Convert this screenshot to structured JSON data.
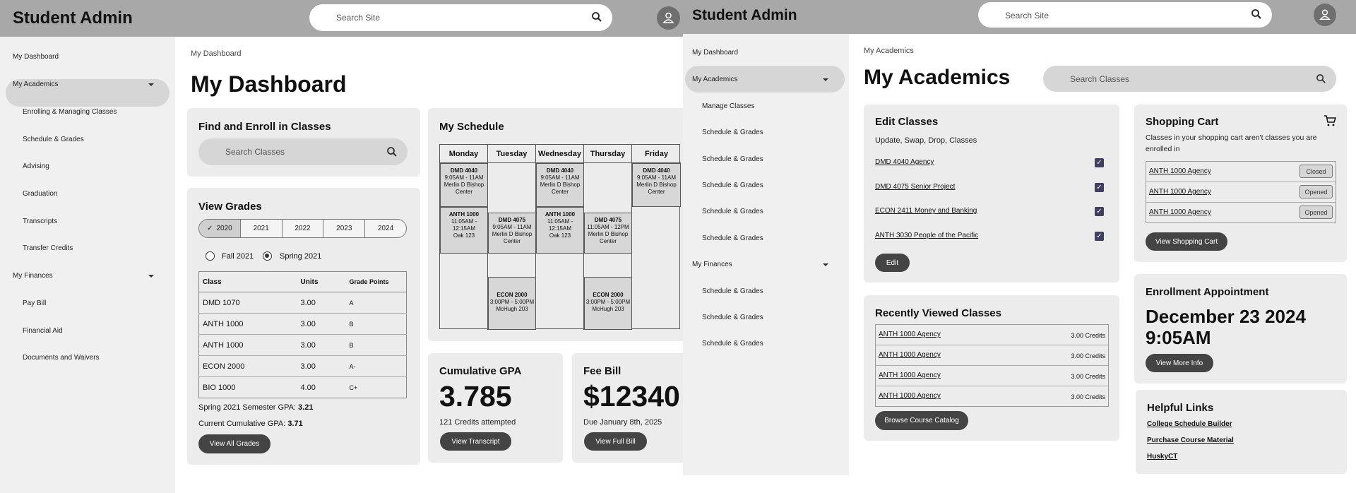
{
  "dashboard": {
    "brand": "Student Admin",
    "search_placeholder": "Search Site",
    "nav": [
      {
        "label": "My Dashboard"
      },
      {
        "label": "My Academics"
      },
      {
        "label": "Enrolling & Managing Classes"
      },
      {
        "label": "Schedule & Grades"
      },
      {
        "label": "Advising"
      },
      {
        "label": "Graduation"
      },
      {
        "label": "Transcripts"
      },
      {
        "label": "Transfer Credits"
      },
      {
        "label": "My Finances"
      },
      {
        "label": "Pay Bill"
      },
      {
        "label": "Financial Aid"
      },
      {
        "label": "Documents and Waivers"
      }
    ],
    "breadcrumb": "My Dashboard",
    "title": "My Dashboard",
    "find_enroll": {
      "title": "Find and Enroll in Classes",
      "search_placeholder": "Search Classes"
    },
    "view_grades": {
      "title": "View Grades",
      "years": [
        "2020",
        "2021",
        "2022",
        "2023",
        "2024"
      ],
      "selected_year": "2020",
      "terms": [
        {
          "label": "Fall 2021",
          "selected": false
        },
        {
          "label": "Spring 2021",
          "selected": true
        }
      ],
      "columns": [
        "Class",
        "Units",
        "Grade Points"
      ],
      "rows": [
        {
          "class": "DMD 1070",
          "units": "3.00",
          "grade": "A"
        },
        {
          "class": "ANTH 1000",
          "units": "3.00",
          "grade": "B"
        },
        {
          "class": "ANTH 1000",
          "units": "3.00",
          "grade": "B"
        },
        {
          "class": "ECON 2000",
          "units": "3.00",
          "grade": "A-"
        },
        {
          "class": "BIO 1000",
          "units": "4.00",
          "grade": "C+"
        }
      ],
      "semester_gpa_label": "Spring 2021 Semester GPA:",
      "semester_gpa": "3.21",
      "cumulative_gpa_label": "Current Cumulative GPA:",
      "cumulative_gpa": "3.71",
      "button": "View All Grades"
    },
    "schedule": {
      "title": "My Schedule",
      "days": [
        "Monday",
        "Tuesday",
        "Wednesday",
        "Thursday",
        "Friday"
      ],
      "events": [
        {
          "day": 0,
          "slot": 0,
          "course": "DMD 4040",
          "time": "9:05AM - 11AM",
          "room": "Merlin D Bishop Center"
        },
        {
          "day": 2,
          "slot": 0,
          "course": "DMD 4040",
          "time": "9:05AM - 11AM",
          "room": "Merlin D Bishop Center"
        },
        {
          "day": 4,
          "slot": 0,
          "course": "DMD 4040",
          "time": "9:05AM - 11AM",
          "room": "Merlin D Bishop Center"
        },
        {
          "day": 1,
          "slot": 1,
          "course": "DMD 4075",
          "time": "9:05AM - 11AM",
          "room": "Merlin D Bishop Center"
        },
        {
          "day": 3,
          "slot": 1,
          "course": "DMD 4075",
          "time": "11:05AM - 12PM",
          "room": "Merlin D Bishop Center"
        },
        {
          "day": 0,
          "slot": 2,
          "course": "ANTH 1000",
          "time": "11:05AM - 12:15AM",
          "room": "Oak 123"
        },
        {
          "day": 2,
          "slot": 2,
          "course": "ANTH 1000",
          "time": "11:05AM - 12:15AM",
          "room": "Oak 123"
        },
        {
          "day": 1,
          "slot": 3,
          "course": "ECON 2000",
          "time": "3:00PM - 5:00PM",
          "room": "McHugh 203"
        },
        {
          "day": 3,
          "slot": 3,
          "course": "ECON 2000",
          "time": "3:00PM - 5:00PM",
          "room": "McHugh 203"
        }
      ]
    },
    "gpa": {
      "title": "Cumulative GPA",
      "value": "3.785",
      "credits": "121 Credits attempted",
      "button": "View Transcript"
    },
    "fee": {
      "title": "Fee Bill",
      "value": "$12340",
      "due": "Due January 8th, 2025",
      "button": "View Full Bill"
    }
  },
  "academics": {
    "brand": "Student Admin",
    "search_placeholder": "Search Site",
    "nav": [
      {
        "label": "My Dashboard"
      },
      {
        "label": "My Academics"
      },
      {
        "label": "Manage Classes"
      },
      {
        "label": "Schedule & Grades"
      },
      {
        "label": "Schedule & Grades"
      },
      {
        "label": "Schedule & Grades"
      },
      {
        "label": "Schedule & Grades"
      },
      {
        "label": "Schedule & Grades"
      },
      {
        "label": "My Finances"
      },
      {
        "label": "Schedule & Grades"
      },
      {
        "label": "Schedule & Grades"
      },
      {
        "label": "Schedule & Grades"
      }
    ],
    "breadcrumb": "My Academics",
    "title": "My Academics",
    "class_search_placeholder": "Search Classes",
    "edit_classes": {
      "title": "Edit Classes",
      "subtitle": "Update, Swap, Drop, Classes",
      "items": [
        {
          "label": "DMD 4040 Agency",
          "checked": true
        },
        {
          "label": "DMD 4075 Senior Project",
          "checked": true
        },
        {
          "label": "ECON 2411 Money and Banking",
          "checked": true
        },
        {
          "label": "ANTH 3030 People of the Pacific",
          "checked": true
        }
      ],
      "button": "Edit"
    },
    "recent": {
      "title": "Recently Viewed Classes",
      "items": [
        {
          "label": "ANTH 1000 Agency",
          "credits": "3.00 Credits"
        },
        {
          "label": "ANTH 1000 Agency",
          "credits": "3.00 Credits"
        },
        {
          "label": "ANTH 1000 Agency",
          "credits": "3.00 Credits"
        },
        {
          "label": "ANTH 1000 Agency",
          "credits": "3.00 Credits"
        }
      ],
      "button": "Browse Course Catalog"
    },
    "cart": {
      "title": "Shopping Cart",
      "subtitle": "Classes in your shopping cart aren't classes you are enrolled in",
      "items": [
        {
          "label": "ANTH 1000 Agency",
          "status": "Closed"
        },
        {
          "label": "ANTH 1000 Agency",
          "status": "Opened"
        },
        {
          "label": "ANTH 1000 Agency",
          "status": "Opened"
        }
      ],
      "button": "View Shopping Cart"
    },
    "appointment": {
      "title": "Enrollment Appointment",
      "date": "December 23 2024",
      "time": "9:05AM",
      "button": "View More Info"
    },
    "links": {
      "title": "Helpful Links",
      "items": [
        "College Schedule Builder",
        "Purchase Course Material",
        "HuskyCT"
      ]
    }
  },
  "colors": {
    "header": "#a8a8a8",
    "sidebar": "#f0f0f0",
    "card": "#ececec",
    "button": "#444444",
    "selected": "#d6d6d6"
  }
}
